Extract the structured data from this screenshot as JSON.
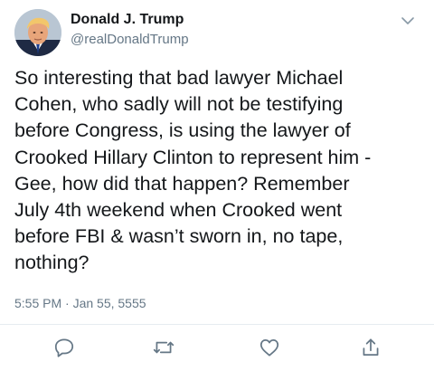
{
  "author": {
    "display_name": "Donald J. Trump",
    "handle": "@realDonaldTrump"
  },
  "tweet": {
    "lines": [
      "So interesting that bad lawyer Michael",
      "Cohen, who sadly will not be testifying",
      "before Congress, is using the lawyer of",
      "Crooked Hillary Clinton to represent him -",
      "Gee, how did that happen? Remember",
      "July 4th weekend when Crooked went",
      "before FBI & wasn’t sworn in, no tape,",
      "nothing?"
    ],
    "timestamp": "5:55 PM · Jan 55, 5555"
  },
  "icons": {
    "menu": "chevron-down-icon",
    "reply": "reply-icon",
    "retweet": "retweet-icon",
    "like": "heart-icon",
    "share": "share-icon",
    "icon_color": "#657786"
  }
}
